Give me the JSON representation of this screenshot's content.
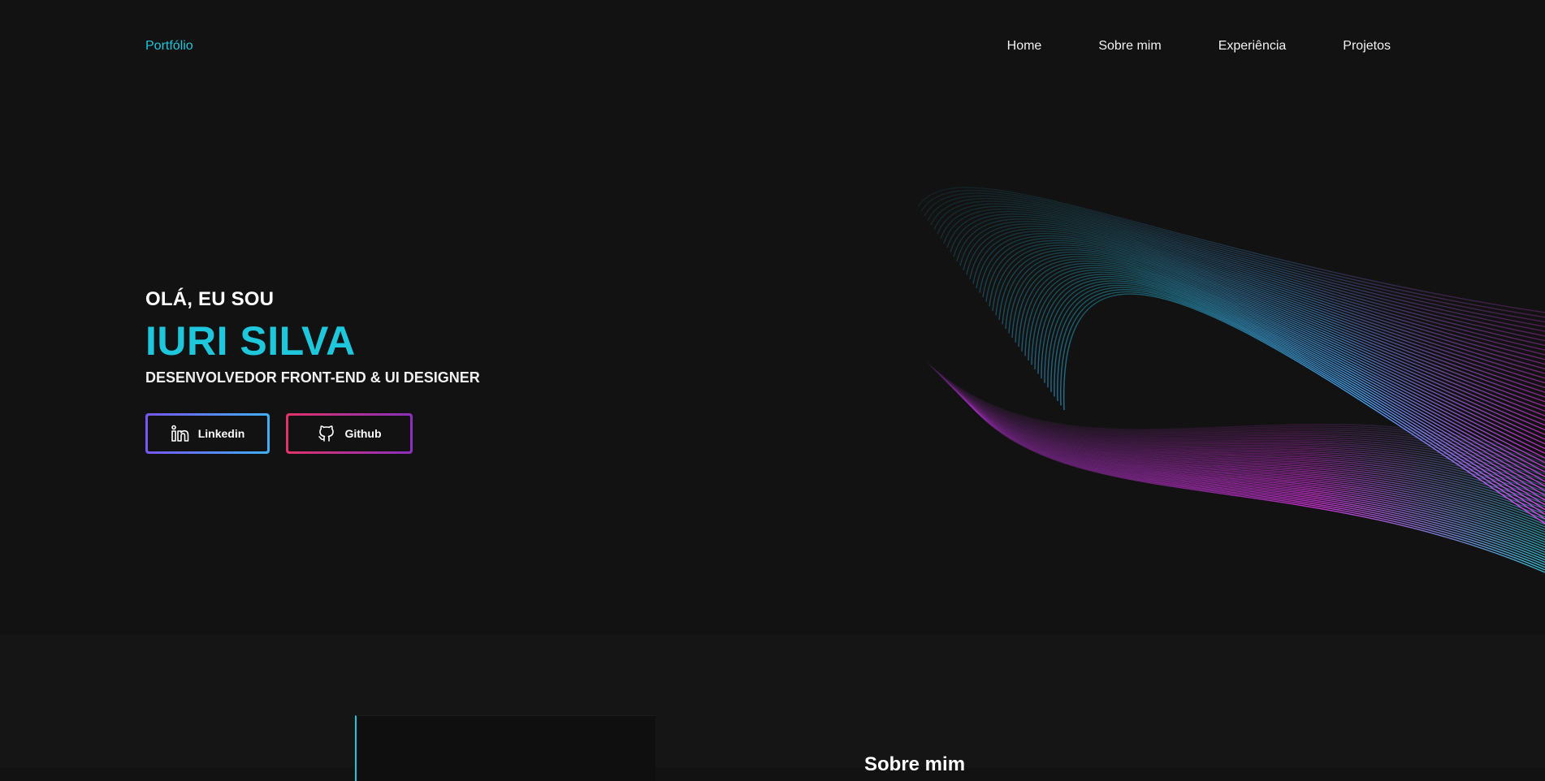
{
  "nav": {
    "brand": "Portfólio",
    "links": [
      "Home",
      "Sobre mim",
      "Experiência",
      "Projetos"
    ]
  },
  "hero": {
    "greeting": "OLÁ, EU SOU",
    "name": "IURI SILVA",
    "role": "DESENVOLVEDOR FRONT-END & UI DESIGNER",
    "buttons": {
      "linkedin": {
        "label": "Linkedin",
        "icon": "linkedin-icon"
      },
      "github": {
        "label": "Github",
        "icon": "github-icon"
      }
    }
  },
  "about": {
    "title": "Sobre mim"
  },
  "colors": {
    "background": "#121212",
    "accent": "#1fc7dd",
    "wave_pink": "#e637f0",
    "wave_blue": "#3fd8f2"
  }
}
